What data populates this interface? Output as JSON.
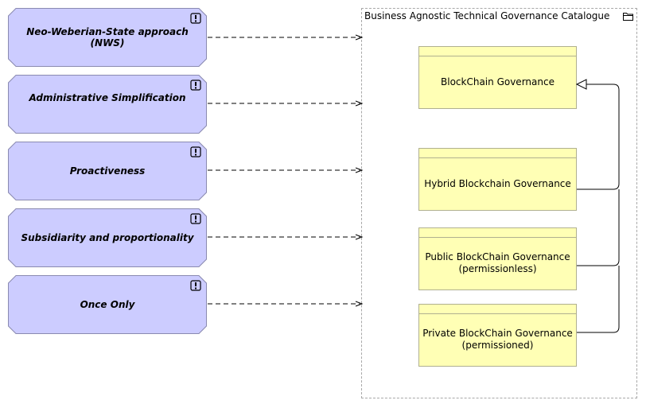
{
  "principles": [
    {
      "label": "Neo-Weberian-State approach (NWS)",
      "badge_icon": "exclamation-badge-icon"
    },
    {
      "label": "Administrative Simplification",
      "badge_icon": "exclamation-badge-icon"
    },
    {
      "label": "Proactiveness",
      "badge_icon": "exclamation-badge-icon"
    },
    {
      "label": "Subsidiarity and proportionality",
      "badge_icon": "exclamation-badge-icon"
    },
    {
      "label": "Once Only",
      "badge_icon": "exclamation-badge-icon"
    }
  ],
  "group": {
    "title": "Business Agnostic Technical Governance Catalogue",
    "icon": "folder-icon",
    "objects": [
      {
        "line1": "BlockChain Governance",
        "line2": ""
      },
      {
        "line1": "Hybrid Blockchain Governance",
        "line2": ""
      },
      {
        "line1": "Public BlockChain Governance",
        "line2": "(permissionless)"
      },
      {
        "line1": "Private BlockChain Governance",
        "line2": "(permissioned)"
      }
    ]
  },
  "colors": {
    "principle_fill": "#ccccff",
    "principle_stroke": "#8a8ab0",
    "object_fill": "#ffffb5",
    "group_border": "#a8a8a8"
  }
}
